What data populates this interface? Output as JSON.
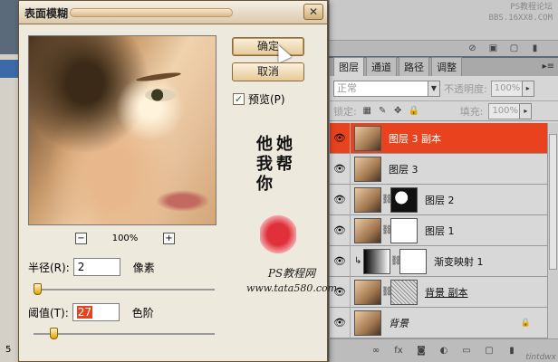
{
  "background": {
    "status_num": "5"
  },
  "watermark": {
    "line1": "PS教程论坛",
    "line2": "BBS.16XX8.COM"
  },
  "dialog": {
    "title": "表面模糊",
    "close": "✕",
    "ok_label": "确定",
    "cancel_label": "取消",
    "preview_label": "预览(P)",
    "preview_checked": true,
    "zoom": "100%",
    "zoom_out": "−",
    "zoom_in": "+",
    "radius_label": "半径(R):",
    "radius_value": "2",
    "radius_unit": "像素",
    "threshold_label": "阈值(T):",
    "threshold_value": "27",
    "threshold_unit": "色阶",
    "calligraphy": [
      "他",
      "她",
      "我",
      "帮",
      "你"
    ],
    "seal_text": "",
    "brand": "PS教程网",
    "brand_url": "www.tata580.com"
  },
  "layers_panel": {
    "tabs": [
      "图层",
      "通道",
      "路径",
      "调整"
    ],
    "active_tab": 0,
    "blend_mode": "正常",
    "opacity_label": "不透明度:",
    "opacity_value": "100%",
    "lock_label": "锁定:",
    "fill_label": "填充:",
    "fill_value": "100%",
    "layers": [
      {
        "name": "图层 3 副本",
        "selected": true,
        "thumb": "photo",
        "mask": null
      },
      {
        "name": "图层 3",
        "selected": false,
        "thumb": "photo",
        "mask": null
      },
      {
        "name": "图层 2",
        "selected": false,
        "thumb": "photo",
        "mask": "mask"
      },
      {
        "name": "图层 1",
        "selected": false,
        "thumb": "photo",
        "mask": "white"
      },
      {
        "name": "渐变映射 1",
        "selected": false,
        "thumb": "grad",
        "mask": "white"
      },
      {
        "name": "背景 副本",
        "selected": false,
        "thumb": "photo",
        "mask": "sketch"
      },
      {
        "name": "背景",
        "selected": false,
        "thumb": "photo",
        "mask": null
      }
    ],
    "bottom_brand": "tintdwx"
  }
}
